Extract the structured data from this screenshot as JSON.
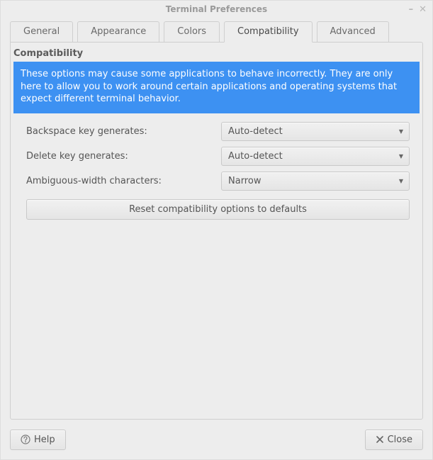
{
  "window": {
    "title": "Terminal Preferences"
  },
  "tabs": {
    "general": "General",
    "appearance": "Appearance",
    "colors": "Colors",
    "compatibility": "Compatibility",
    "advanced": "Advanced"
  },
  "panel": {
    "heading": "Compatibility",
    "info": "These options may cause some applications to behave incorrectly. They are only here to allow you to work around certain applications and operating systems that expect different terminal behavior.",
    "backspace": {
      "label": "Backspace key generates:",
      "value": "Auto-detect"
    },
    "delete": {
      "label": "Delete key generates:",
      "value": "Auto-detect"
    },
    "ambiguous": {
      "label": "Ambiguous-width characters:",
      "value": "Narrow"
    },
    "reset": "Reset compatibility options to defaults"
  },
  "actions": {
    "help": "Help",
    "close": "Close"
  }
}
